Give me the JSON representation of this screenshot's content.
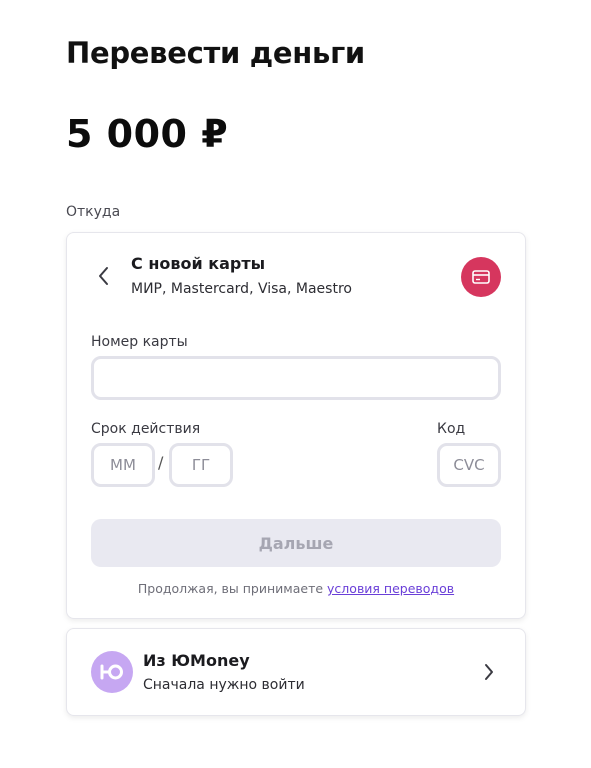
{
  "page": {
    "title": "Перевести деньги",
    "amount": "5 000 ₽",
    "from_label": "Откуда"
  },
  "new_card": {
    "title": "С новой карты",
    "subtitle": "МИР, Mastercard, Visa, Maestro",
    "badge_icon": "credit-card-icon",
    "badge_color": "#d6365e",
    "card_number_label": "Номер карты",
    "card_number_value": "",
    "expiry_label": "Срок действия",
    "month_placeholder": "ММ",
    "year_placeholder": "ГГ",
    "date_separator": "/",
    "code_label": "Код",
    "cvc_placeholder": "CVC",
    "next_button": "Дальше",
    "terms_text": "Продолжая, вы принимаете",
    "terms_link": "условия переводов"
  },
  "yoomoney": {
    "title": "Из ЮMoney",
    "subtitle": "Сначала нужно войти",
    "logo_color": "#c6a7f2"
  }
}
